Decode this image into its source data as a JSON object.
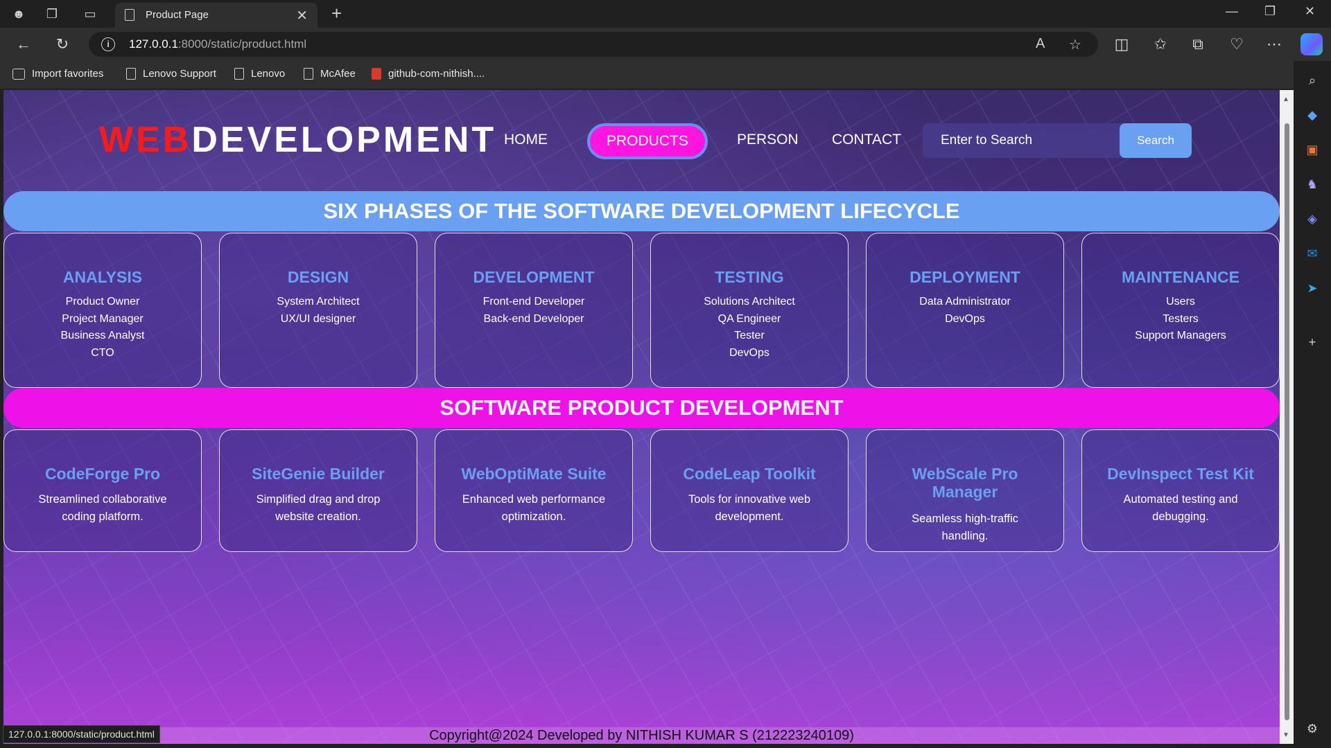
{
  "browser": {
    "tab_title": "Product Page",
    "url_host": "127.0.0.1",
    "url_rest": ":8000/static/product.html",
    "favorites": [
      "Import favorites",
      "Lenovo Support",
      "Lenovo",
      "McAfee",
      "github-com-nithish...."
    ],
    "status_url": "127.0.0.1:8000/static/product.html"
  },
  "header": {
    "logo_part1": "WEB",
    "logo_part2": "DEVELOPMENT",
    "nav": [
      "HOME",
      "PRODUCTS",
      "PERSON",
      "CONTACT"
    ],
    "active_nav": "PRODUCTS",
    "search_placeholder": "Enter to Search",
    "search_button": "Search"
  },
  "phases_banner": "SIX PHASES OF THE SOFTWARE DEVELOPMENT LIFECYCLE",
  "phases": [
    {
      "title": "ANALYSIS",
      "roles": [
        "Product Owner",
        "Project Manager",
        "Business Analyst",
        "CTO"
      ]
    },
    {
      "title": "DESIGN",
      "roles": [
        "System Architect",
        "UX/UI designer"
      ]
    },
    {
      "title": "DEVELOPMENT",
      "roles": [
        "Front-end Developer",
        "Back-end Developer"
      ]
    },
    {
      "title": "TESTING",
      "roles": [
        "Solutions Architect",
        "QA Engineer",
        "Tester",
        "DevOps"
      ]
    },
    {
      "title": "DEPLOYMENT",
      "roles": [
        "Data Administrator",
        "DevOps"
      ]
    },
    {
      "title": "MAINTENANCE",
      "roles": [
        "Users",
        "Testers",
        "Support Managers"
      ]
    }
  ],
  "products_banner": "SOFTWARE PRODUCT DEVELOPMENT",
  "products": [
    {
      "title": "CodeForge Pro",
      "desc": "Streamlined collaborative coding platform."
    },
    {
      "title": "SiteGenie Builder",
      "desc": "Simplified drag and drop website creation."
    },
    {
      "title": "WebOptiMate Suite",
      "desc": "Enhanced web performance optimization."
    },
    {
      "title": "CodeLeap Toolkit",
      "desc": "Tools for innovative web development."
    },
    {
      "title": "WebScale Pro Manager",
      "desc": "Seamless high-traffic handling."
    },
    {
      "title": "DevInspect Test Kit",
      "desc": "Automated testing and debugging."
    }
  ],
  "footer": "Copyright@2024 Developed by NITHISH KUMAR S (212223240109)",
  "colors": {
    "accent_blue": "#6aa0f2",
    "accent_pink": "#ee12e8",
    "logo_red": "#ff1a1a"
  }
}
